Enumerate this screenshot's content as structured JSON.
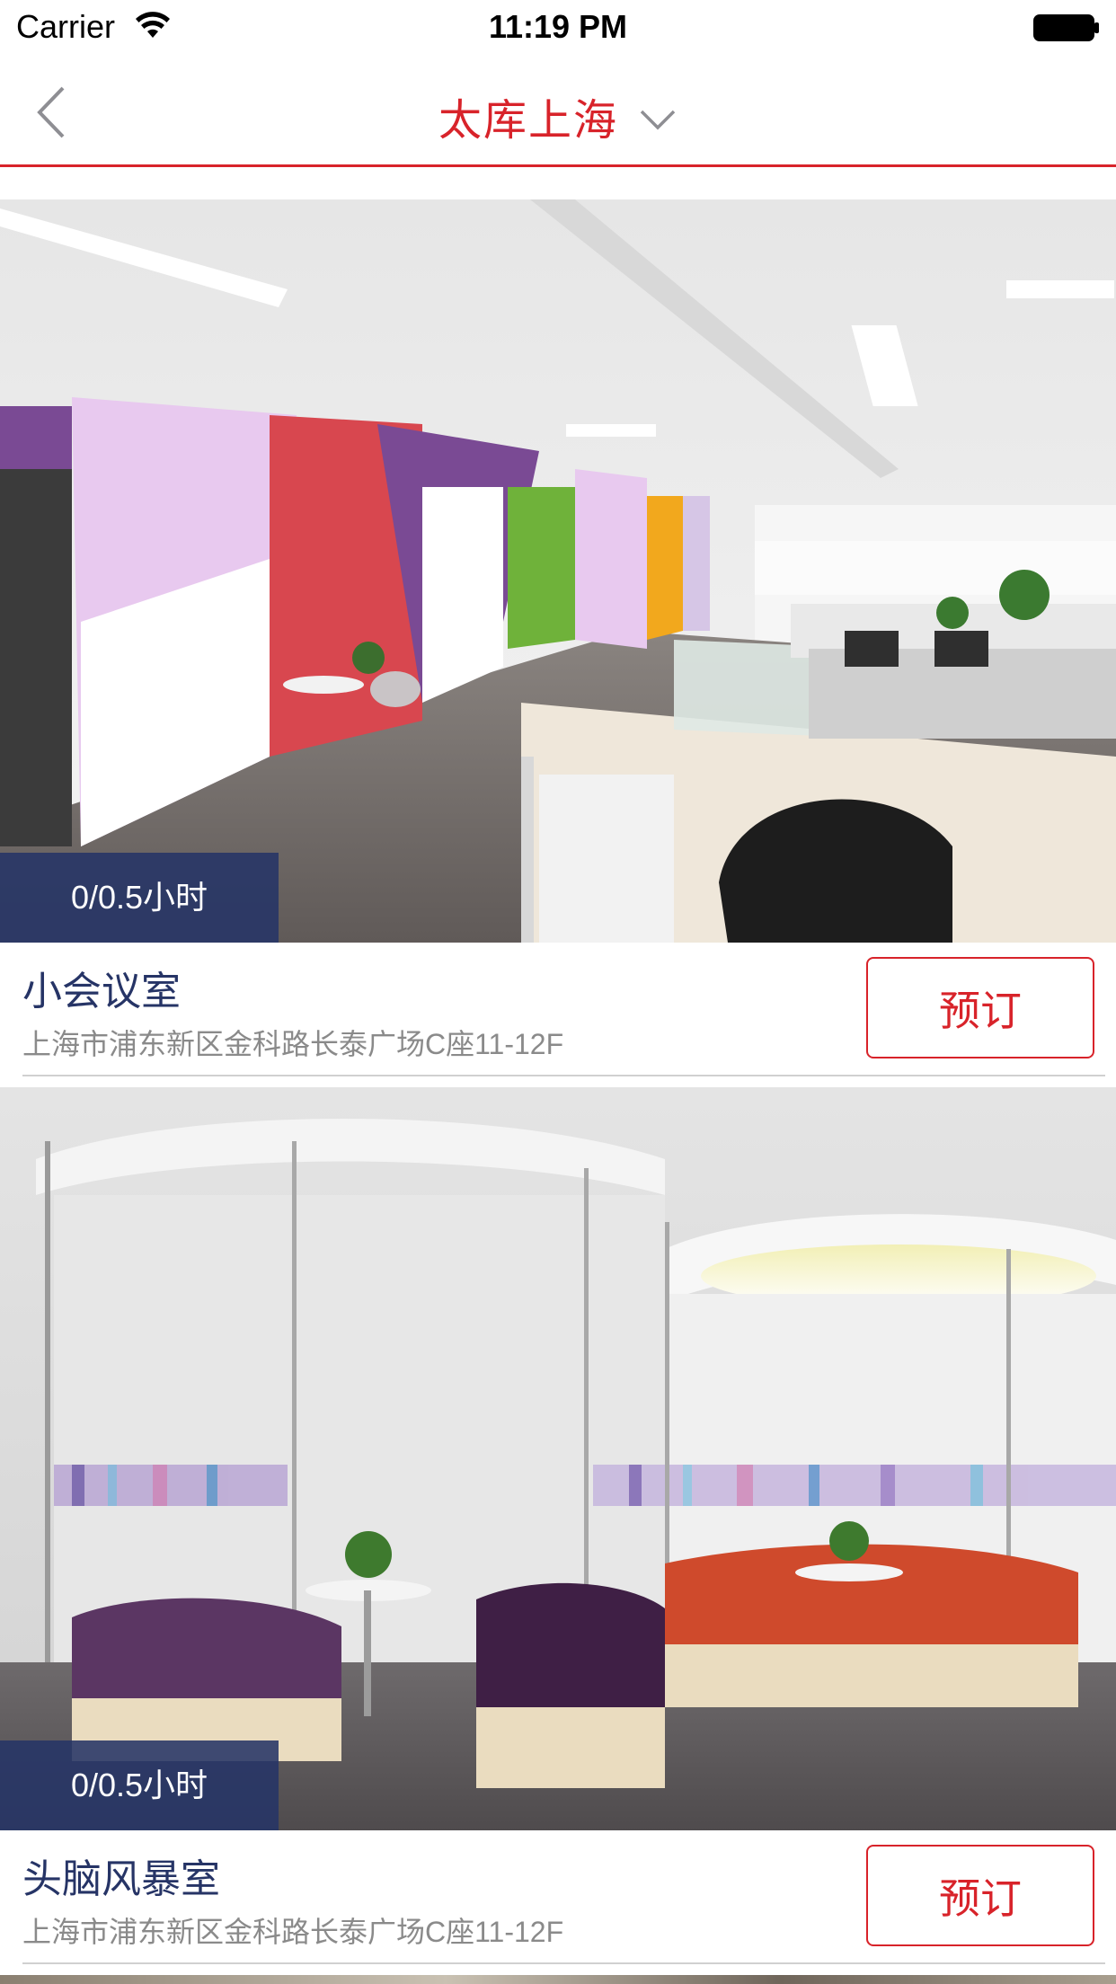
{
  "status_bar": {
    "carrier": "Carrier",
    "time": "11:19 PM",
    "icons": [
      "wifi-icon",
      "battery-icon"
    ]
  },
  "nav": {
    "back_icon": "chevron-left-icon",
    "title": "太库上海",
    "dropdown_icon": "chevron-down-icon",
    "accent_color": "#d8232a"
  },
  "rooms": [
    {
      "price": "0/0.5小时",
      "name": "小会议室",
      "address": "上海市浦东新区金科路长泰广场C座11-12F",
      "book_label": "预订",
      "photo": "open-office-with-colorful-booths"
    },
    {
      "price": "0/0.5小时",
      "name": "头脑风暴室",
      "address": "上海市浦东新区金科路长泰广场C座11-12F",
      "book_label": "预订",
      "photo": "circular-glass-lounge-rooms"
    }
  ],
  "colors": {
    "accent": "#d8232a",
    "room_name": "#263466",
    "price_badge": "#263466",
    "address": "#8a8a8a"
  }
}
